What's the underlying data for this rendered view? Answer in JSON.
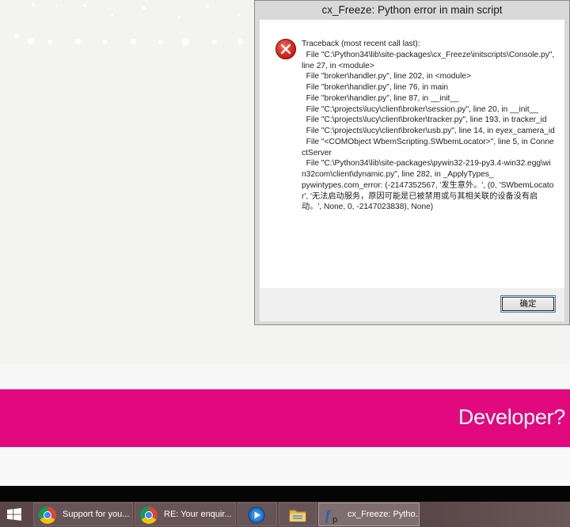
{
  "background": {
    "band_text": "Developer?",
    "pink": "#e2087e"
  },
  "dialog": {
    "title": "cx_Freeze: Python error in main script",
    "icon": "error-icon",
    "message": "Traceback (most recent call last):\n  File \"C:\\Python34\\lib\\site-packages\\cx_Freeze\\initscripts\\Console.py\", line 27, in <module>\n  File \"broker\\handler.py\", line 202, in <module>\n  File \"broker\\handler.py\", line 76, in main\n  File \"broker\\handler.py\", line 87, in __init__\n  File \"C:\\projects\\lucy\\client\\broker\\session.py\", line 20, in __init__\n  File \"C:\\projects\\lucy\\client\\broker\\tracker.py\", line 193, in tracker_id\n  File \"C:\\projects\\lucy\\client\\broker\\usb.py\", line 14, in eyex_camera_id\n  File \"<COMObject WbemScripting.SWbemLocator>\", line 5, in ConnectServer\n  File \"C:\\Python34\\lib\\site-packages\\pywin32-219-py3.4-win32.egg\\win32com\\client\\dynamic.py\", line 282, in _ApplyTypes_\npywintypes.com_error: (-2147352567, '发生意外。', (0, 'SWbemLocator', '无法启动服务，原因可能是已被禁用或与其相关联的设备没有启动。', None, 0, -2147023838), None)",
    "ok_label": "确定"
  },
  "taskbar": {
    "start_icon": "windows-logo-icon",
    "items": [
      {
        "icon": "chrome-icon",
        "label": "Support for you..."
      },
      {
        "icon": "chrome-icon",
        "label": "RE: Your enquir..."
      },
      {
        "icon": "media-player-icon",
        "label": ""
      },
      {
        "icon": "file-explorer-icon",
        "label": ""
      },
      {
        "icon": "python-freeze-icon",
        "label": "cx_Freeze: Pytho..."
      }
    ]
  }
}
